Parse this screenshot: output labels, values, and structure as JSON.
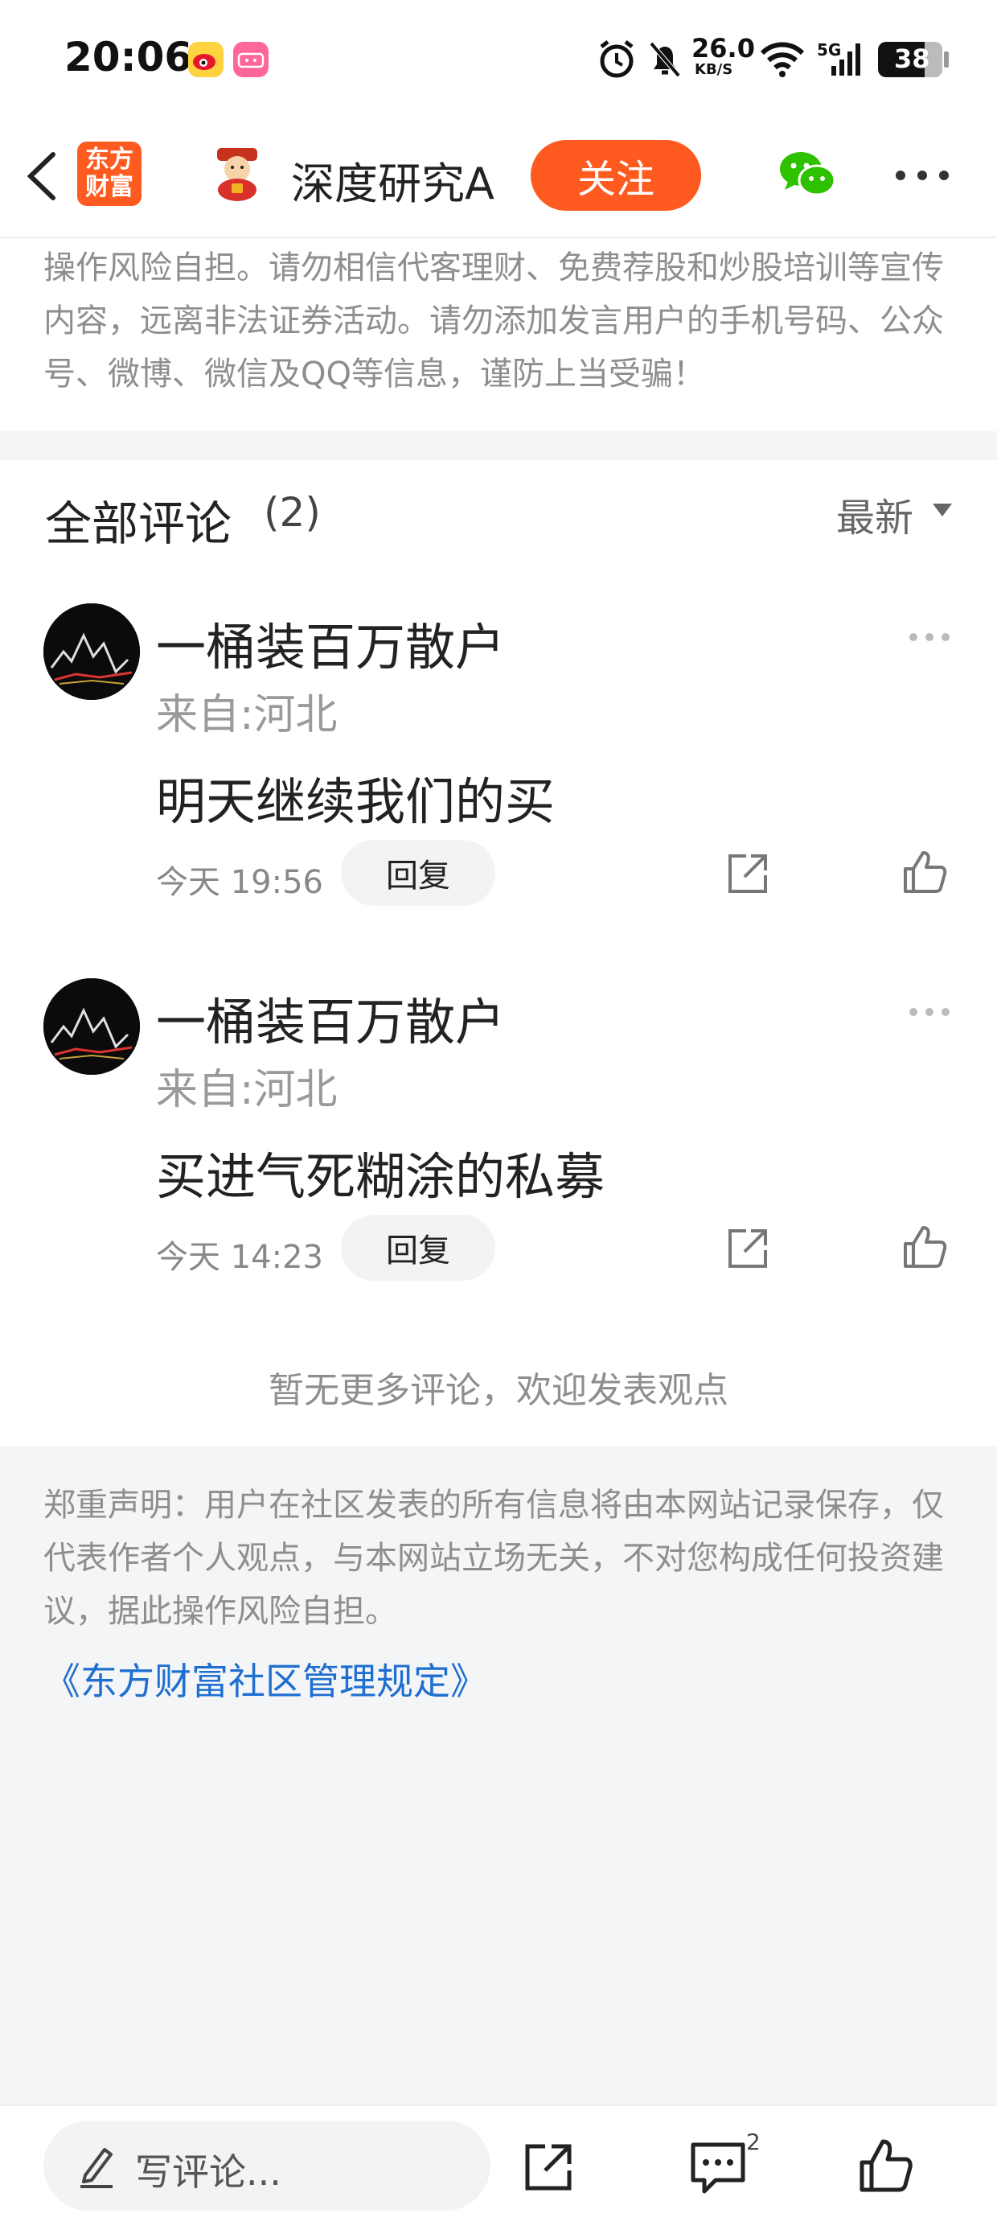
{
  "status_bar": {
    "time": "20:06",
    "net_speed_value": "26.0",
    "net_speed_unit": "KB/S",
    "network": "5G",
    "battery": "38",
    "app_badge_2": "bilibili"
  },
  "header": {
    "brand_line1": "东方",
    "brand_line2": "财富",
    "account_name": "深度研究A",
    "follow_label": "关注"
  },
  "top_notice": "操作风险自担。请勿相信代客理财、免费荐股和炒股培训等宣传内容，远离非法证券活动。请勿添加发言用户的手机号码、公众号、微博、微信及QQ等信息，谨防上当受骗！",
  "comments": {
    "title": "全部评论",
    "count": "(2)",
    "sort_label": "最新",
    "items": [
      {
        "name": "一桶装百万散户",
        "location": "来自:河北",
        "text": "明天继续我们的买",
        "time": "今天 19:56",
        "reply_label": "回复"
      },
      {
        "name": "一桶装百万散户",
        "location": "来自:河北",
        "text": "买进气死糊涂的私募",
        "time": "今天 14:23",
        "reply_label": "回复"
      }
    ],
    "no_more": "暂无更多评论，欢迎发表观点"
  },
  "legal": {
    "text": "郑重声明：用户在社区发表的所有信息将由本网站记录保存，仅代表作者个人观点，与本网站立场无关，不对您构成任何投资建议，据此操作风险自担。",
    "link": "《东方财富社区管理规定》"
  },
  "bottom_bar": {
    "placeholder": "写评论...",
    "comment_count": "2"
  },
  "colors": {
    "accent": "#ff5a1f",
    "link": "#1f6fd1",
    "muted": "#8e8e8e",
    "bg": "#f4f5f7"
  }
}
